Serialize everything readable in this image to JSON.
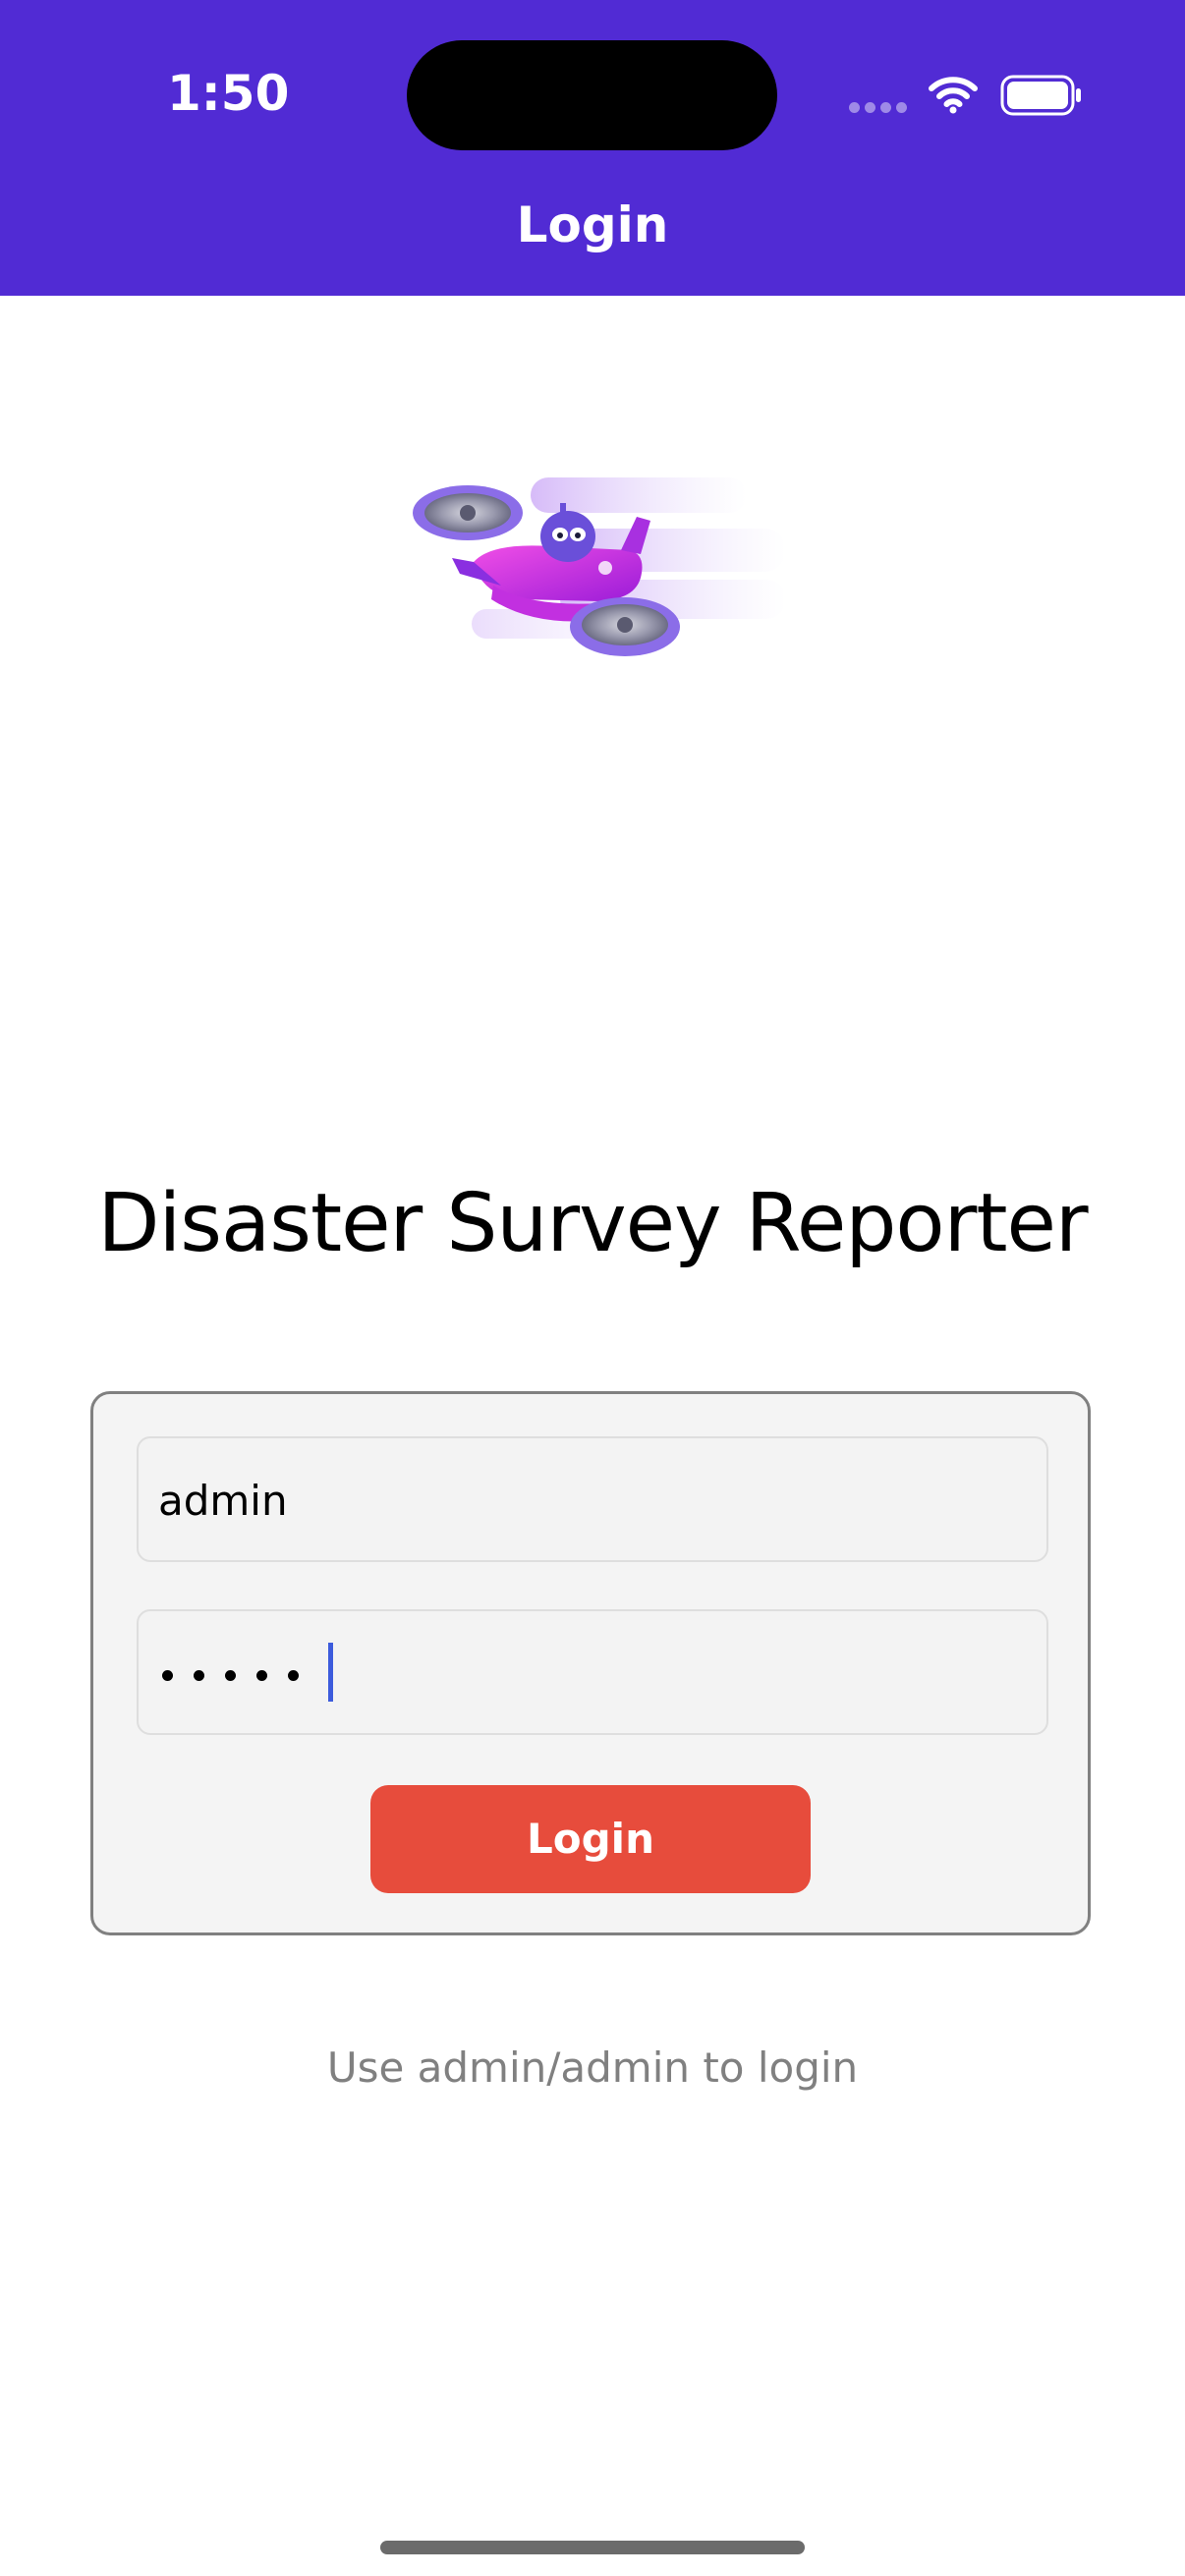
{
  "status_bar": {
    "time": "1:50"
  },
  "nav": {
    "title": "Login"
  },
  "app": {
    "title": "Disaster Survey Reporter"
  },
  "login_form": {
    "username_value": "admin",
    "password_value_masked": "•••••",
    "login_button_label": "Login"
  },
  "hint": {
    "text": "Use admin/admin to login"
  },
  "colors": {
    "nav_bar": "#512bd4",
    "login_button": "#e74c3c",
    "card_background": "#f4f4f4",
    "caret": "#3c5bdc"
  },
  "icons": {
    "wifi": "wifi-icon",
    "battery": "battery-icon",
    "signal": "cellular-signal-icon",
    "illustration": "dotnet-bot-airplane-illustration"
  }
}
